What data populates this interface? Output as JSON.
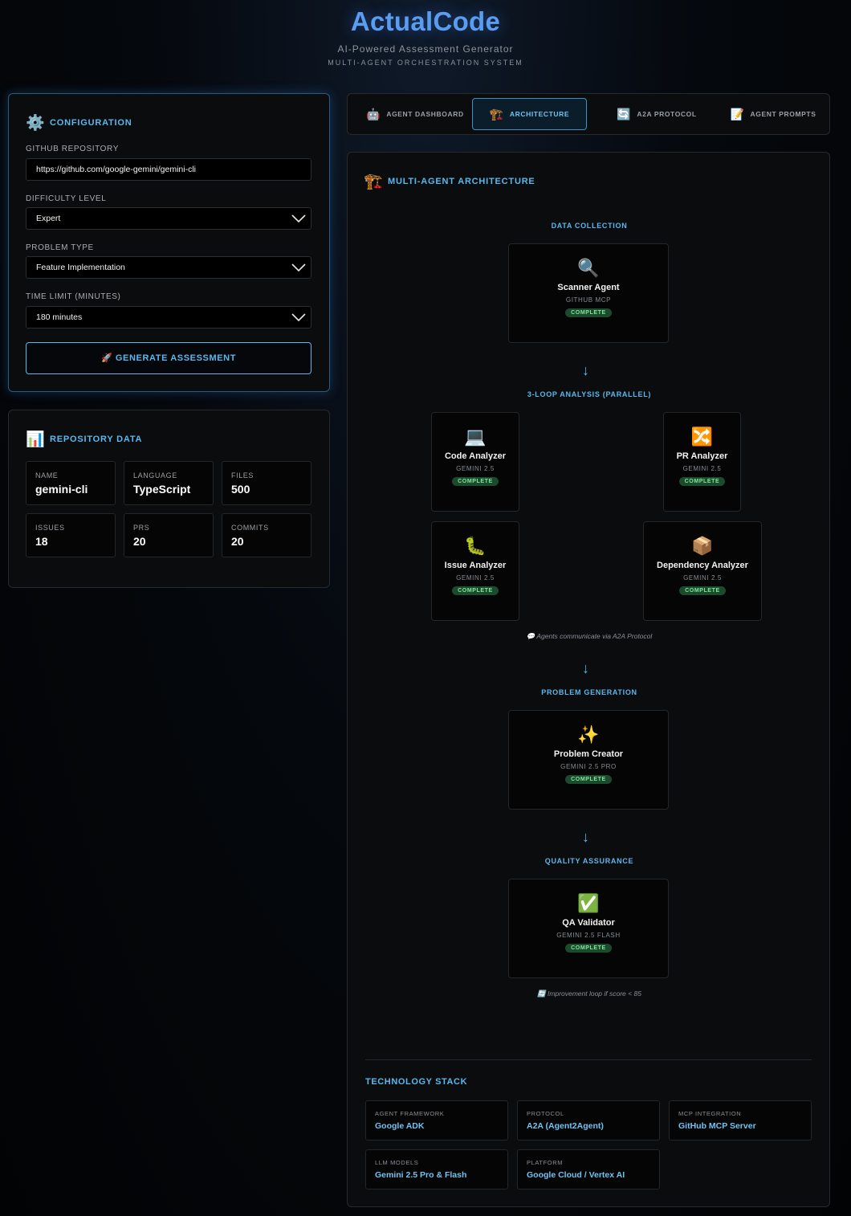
{
  "header": {
    "title": "ActualCode",
    "subtitle": "AI-Powered Assessment Generator",
    "tagline": "MULTI-AGENT ORCHESTRATION SYSTEM"
  },
  "configuration": {
    "heading": "CONFIGURATION",
    "icon": "gear-icon",
    "repo_label": "GITHUB REPOSITORY",
    "repo_value": "https://github.com/google-gemini/gemini-cli",
    "difficulty_label": "DIFFICULTY LEVEL",
    "difficulty_value": "Expert",
    "problem_type_label": "PROBLEM TYPE",
    "problem_type_value": "Feature Implementation",
    "time_limit_label": "TIME LIMIT (MINUTES)",
    "time_limit_value": "180 minutes",
    "generate_button": "🚀 GENERATE ASSESSMENT"
  },
  "repository": {
    "heading": "REPOSITORY DATA",
    "icon": "bar-chart-icon",
    "stats": [
      {
        "label": "NAME",
        "value": "gemini-cli"
      },
      {
        "label": "LANGUAGE",
        "value": "TypeScript"
      },
      {
        "label": "FILES",
        "value": "500"
      },
      {
        "label": "ISSUES",
        "value": "18"
      },
      {
        "label": "PRS",
        "value": "20"
      },
      {
        "label": "COMMITS",
        "value": "20"
      }
    ]
  },
  "tabs": [
    {
      "label": "AGENT DASHBOARD",
      "icon": "🤖",
      "active": false
    },
    {
      "label": "ARCHITECTURE",
      "icon": "🏗️",
      "active": true
    },
    {
      "label": "A2A PROTOCOL",
      "icon": "🔄",
      "active": false
    },
    {
      "label": "AGENT PROMPTS",
      "icon": "📝",
      "active": false
    }
  ],
  "architecture": {
    "heading": "MULTI-AGENT ARCHITECTURE",
    "icon": "🏗️",
    "stages": {
      "data_collection": "DATA COLLECTION",
      "analysis": "3-LOOP ANALYSIS (PARALLEL)",
      "generation": "PROBLEM GENERATION",
      "qa": "QUALITY ASSURANCE"
    },
    "agents": [
      {
        "icon": "🔍",
        "name": "Scanner Agent",
        "model": "GITHUB MCP",
        "status": "COMPLETE"
      },
      {
        "icon": "💻",
        "name": "Code Analyzer",
        "model": "GEMINI 2.5",
        "status": "COMPLETE"
      },
      {
        "icon": "🔀",
        "name": "PR Analyzer",
        "model": "GEMINI 2.5",
        "status": "COMPLETE"
      },
      {
        "icon": "🐛",
        "name": "Issue Analyzer",
        "model": "GEMINI 2.5",
        "status": "COMPLETE"
      },
      {
        "icon": "📦",
        "name": "Dependency Analyzer",
        "model": "GEMINI 2.5",
        "status": "COMPLETE"
      },
      {
        "icon": "✨",
        "name": "Problem Creator",
        "model": "GEMINI 2.5 PRO",
        "status": "COMPLETE"
      },
      {
        "icon": "✅",
        "name": "QA Validator",
        "model": "GEMINI 2.5 FLASH",
        "status": "COMPLETE"
      }
    ],
    "a2a_note": "💬 Agents communicate via A2A Protocol",
    "loop_note": "🔄 Improvement loop if score < 85",
    "arrow": "↓"
  },
  "tech_stack": {
    "heading": "TECHNOLOGY STACK",
    "items": [
      {
        "label": "AGENT FRAMEWORK",
        "value": "Google ADK"
      },
      {
        "label": "PROTOCOL",
        "value": "A2A (Agent2Agent)"
      },
      {
        "label": "MCP INTEGRATION",
        "value": "GitHub MCP Server"
      },
      {
        "label": "LLM MODELS",
        "value": "Gemini 2.5 Pro & Flash"
      },
      {
        "label": "PLATFORM",
        "value": "Google Cloud / Vertex AI"
      }
    ]
  },
  "colors": {
    "accent": "#5ab8ee",
    "title": "#5a9cf0",
    "complete_bg": "#1c4a2d",
    "complete_text": "#7ee79a"
  }
}
